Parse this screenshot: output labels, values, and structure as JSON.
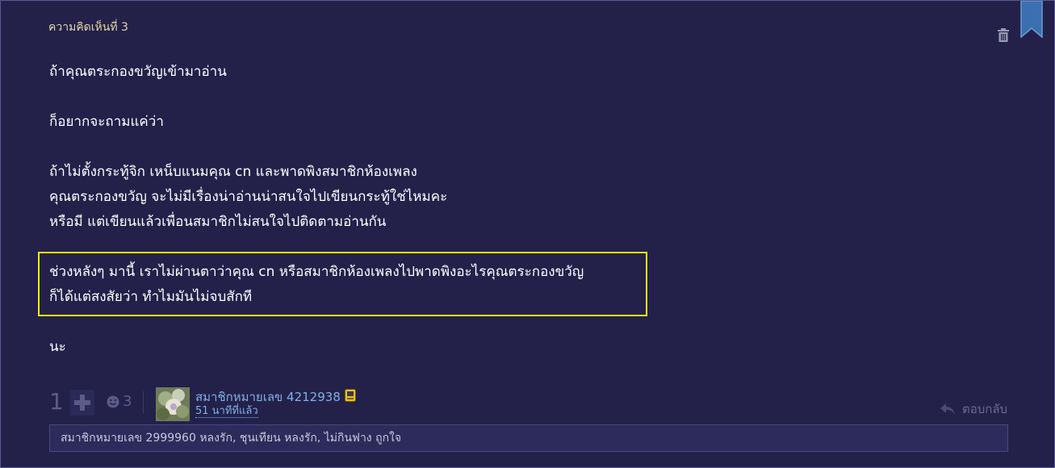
{
  "comment": {
    "number_label": "ความคิดเห็นที่ 3",
    "paragraphs": [
      "ถ้าคุณตระกองขวัญเข้ามาอ่าน",
      "ก็อยากจะถามแค่ว่า",
      "ถ้าไม่ตั้งกระทู้จิก เหน็บแนมคุณ cn และพาดพิงสมาชิกห้องเพลง",
      "คุณตระกองขวัญ จะไม่มีเรื่องน่าอ่านน่าสนใจไปเขียนกระทู้ใช่ไหมคะ",
      "หรือมี แต่เขียนแล้วเพื่อนสมาชิกไม่สนใจไปติดตามอ่านกัน",
      "ช่วงหลังๆ มานี้ เราไม่ผ่านตาว่าคุณ cn หรือสมาชิกห้องเพลงไปพาดพิงอะไรคุณตระกองขวัญ",
      "ก็ได้แต่สงสัยว่า ทำไมมันไม่จบสักที",
      "นะ"
    ]
  },
  "footer": {
    "vote_count": "1",
    "emoji_count": "3",
    "member_name": "สมาชิกหมายเลข 4212938",
    "time_ago": "51 นาทีที่แล้ว",
    "reply_label": "ตอบกลับ"
  },
  "reactions": {
    "text": "สมาชิกหมายเลข 2999960 หลงรัก, ชุนเทียน หลงรัก, ไม่กินฟาง ถูกใจ"
  },
  "colors": {
    "background": "#23214a",
    "highlight_border": "#ffee00",
    "link": "#7fb0e6",
    "bookmark": "#3a6fb0"
  },
  "icons": {
    "bookmark": "bookmark-icon",
    "delete": "trash-icon",
    "plus": "plus-icon",
    "emoji": "emoji-icon",
    "reply": "reply-arrow-icon",
    "badge": "member-badge-icon"
  }
}
